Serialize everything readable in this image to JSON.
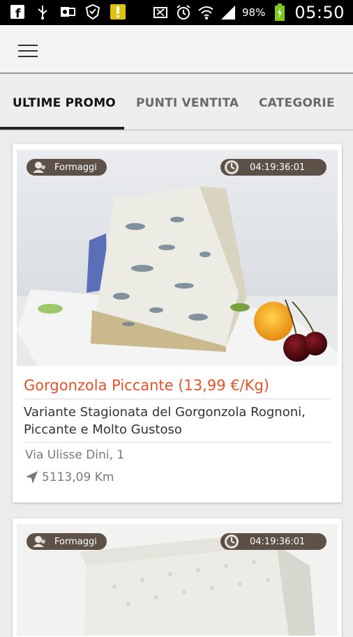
{
  "status_bar": {
    "battery": "98%",
    "time": "05:50"
  },
  "tabs": [
    {
      "label": "ULTIME PROMO",
      "active": true
    },
    {
      "label": "PUNTI VENTITA",
      "active": false
    },
    {
      "label": "CATEGORIE",
      "active": false
    }
  ],
  "cards": [
    {
      "category": "Formaggi",
      "timer": "04:19:36:01",
      "title": "Gorgonzola Piccante (13,99 €/Kg)",
      "description": "Variante Stagionata del Gorgonzola Rognoni, Piccante e Molto Gustoso",
      "address": "Via Ulisse Dini, 1",
      "distance": "5113,09 Km"
    },
    {
      "category": "Formaggi",
      "timer": "04:19:36:01"
    }
  ],
  "colors": {
    "accent": "#e2532a",
    "pill": "#483a30"
  }
}
